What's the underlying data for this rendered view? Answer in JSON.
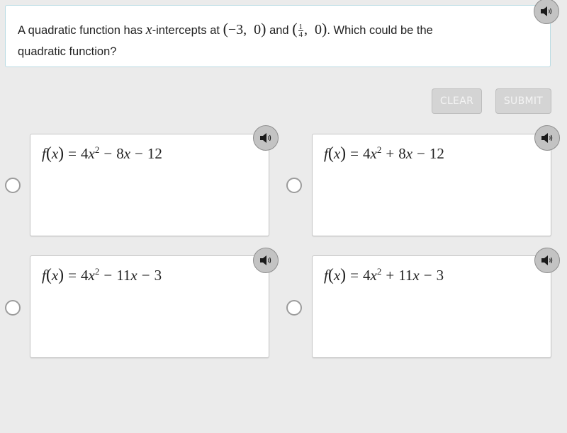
{
  "question": {
    "text_before": "A quadratic function has ",
    "var_x": "x",
    "text_mid": "-intercepts at ",
    "point1": {
      "x": "−3",
      "y": "0"
    },
    "text_and": " and ",
    "point2": {
      "x_num": "1",
      "x_den": "4",
      "y": "0"
    },
    "text_after_line1": ". Which could be the",
    "text_line2": "quadratic function?",
    "audio_icon": "speaker-icon"
  },
  "buttons": {
    "clear_label": "CLEAR",
    "submit_label": "SUBMIT"
  },
  "choices": [
    {
      "fname": "f",
      "var": "x",
      "coef_a": "4",
      "exp": "2",
      "sign_b": "−",
      "b": "8",
      "sign_c": "−",
      "c": "12",
      "audio_icon": "speaker-icon",
      "selected": false
    },
    {
      "fname": "f",
      "var": "x",
      "coef_a": "4",
      "exp": "2",
      "sign_b": "+",
      "b": "8",
      "sign_c": "−",
      "c": "12",
      "audio_icon": "speaker-icon",
      "selected": false
    },
    {
      "fname": "f",
      "var": "x",
      "coef_a": "4",
      "exp": "2",
      "sign_b": "−",
      "b": "11",
      "sign_c": "−",
      "c": "3",
      "audio_icon": "speaker-icon",
      "selected": false
    },
    {
      "fname": "f",
      "var": "x",
      "coef_a": "4",
      "exp": "2",
      "sign_b": "+",
      "b": "11",
      "sign_c": "−",
      "c": "3",
      "audio_icon": "speaker-icon",
      "selected": false
    }
  ],
  "colors": {
    "background": "#ebebeb",
    "question_border": "#b9dbe3",
    "button_bg": "#d4d4d4",
    "button_text": "#f4f4f4",
    "speaker_bg": "#c3c3c3"
  }
}
